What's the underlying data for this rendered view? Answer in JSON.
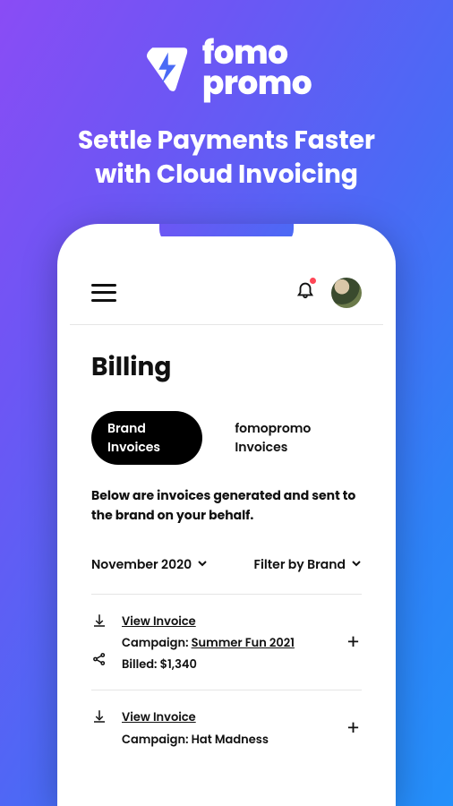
{
  "brand": {
    "name_top": "fomo",
    "name_bottom": "promo"
  },
  "headline_line1": "Settle Payments Faster",
  "headline_line2": "with Cloud Invoicing",
  "screen": {
    "page_title": "Billing",
    "tabs": {
      "active": "Brand Invoices",
      "other": "fomopromo Invoices"
    },
    "description": "Below are invoices generated and sent to the brand on your behalf.",
    "filters": {
      "date": "November 2020",
      "brand": "Filter by Brand"
    },
    "labels": {
      "view_invoice": "View Invoice",
      "campaign_prefix": "Campaign: ",
      "billed_prefix": "Billed: "
    },
    "invoices": [
      {
        "campaign": "Summer Fun 2021",
        "campaign_underline": true,
        "billed": "$1,340"
      },
      {
        "campaign": "Hat Madness",
        "campaign_underline": false,
        "billed": ""
      }
    ]
  }
}
